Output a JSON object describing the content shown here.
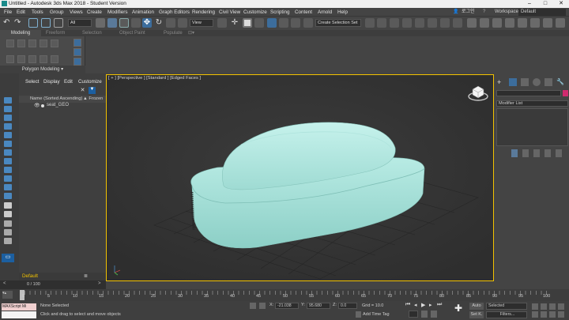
{
  "window": {
    "title": "Untitled - Autodesk 3ds Max 2018 - Student Version"
  },
  "menu": {
    "items": [
      "File",
      "Edit",
      "Tools",
      "Group",
      "Views",
      "Create",
      "Modifiers",
      "Animation",
      "Graph Editors",
      "Rendering",
      "Civil View",
      "Customize",
      "Scripting",
      "Content",
      "Arnold",
      "Help"
    ],
    "user": "로그인",
    "workspaces_label": "Workspaces:",
    "workspace_value": "Default"
  },
  "toolbar": {
    "filter_value": "All",
    "coord_value": "View",
    "selection_set_placeholder": "Create Selection Set"
  },
  "ribbon": {
    "tabs": [
      "Modeling",
      "Freeform",
      "Selection",
      "Object Paint",
      "Populate"
    ],
    "active_tab": "Modeling",
    "panel_label": "Polygon Modeling"
  },
  "explorer": {
    "menu": [
      "Select",
      "Display",
      "Edit",
      "Customize"
    ],
    "column_name": "Name (Sorted Ascending)",
    "column_frozen": "▲ Frozen",
    "objects": [
      {
        "name": "seat_GEO"
      }
    ],
    "layer": "Default"
  },
  "viewport": {
    "label": "[ + ] [Perspective ] [Standard ] [Edged Faces ]",
    "object_color": "#a4ddd6",
    "border_color": "#f2c200"
  },
  "command_panel": {
    "modifier_list_label": "Modifier List"
  },
  "timeline": {
    "frame_display": "0 / 100",
    "ticks": [
      "0",
      "5",
      "10",
      "15",
      "20",
      "25",
      "30",
      "35",
      "40",
      "45",
      "50",
      "55",
      "60",
      "65",
      "70",
      "75",
      "80",
      "85",
      "90",
      "95",
      "100"
    ]
  },
  "status": {
    "maxscript_text": "MAXScript Mi",
    "selection_text": "None Selected",
    "prompt_text": "Click and drag to select and move objects",
    "x_label": "X:",
    "y_label": "Y:",
    "z_label": "Z:",
    "x_value": "-21.038",
    "y_value": "95.680",
    "z_value": "0.0",
    "grid_text": "Grid = 10.0",
    "add_time_tag": "Add Time Tag",
    "auto_label": "Auto",
    "set_key_label": "Set K.",
    "key_mode_value": "Selected",
    "filters_label": "Filters..."
  }
}
